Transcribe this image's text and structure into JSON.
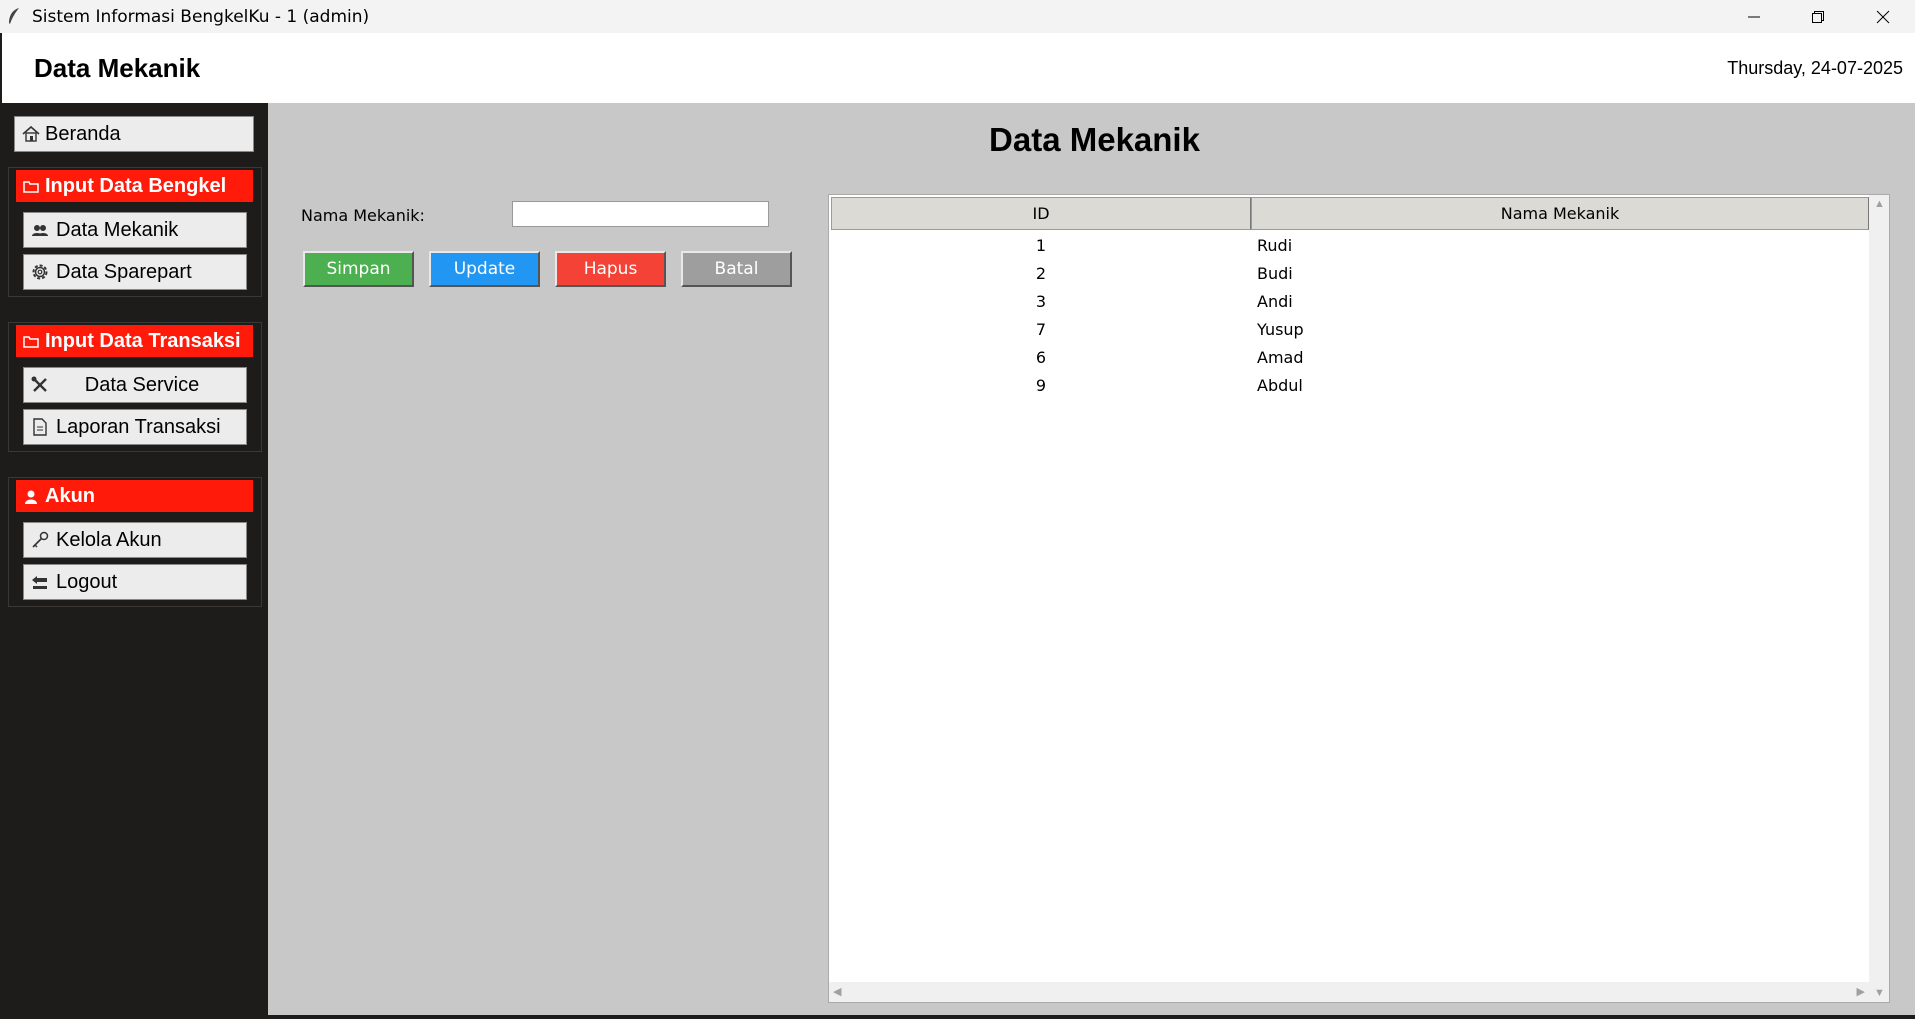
{
  "window": {
    "title": "Sistem Informasi BengkelKu - 1 (admin)"
  },
  "header": {
    "title": "Data Mekanik",
    "date": "Thursday, 24-07-2025"
  },
  "sidebar": {
    "home_label": "Beranda",
    "groups": [
      {
        "title": "Input Data Bengkel",
        "items": [
          {
            "label": "Data Mekanik",
            "icon": "users-icon"
          },
          {
            "label": "Data Sparepart",
            "icon": "gear-icon"
          }
        ]
      },
      {
        "title": "Input Data Transaksi",
        "items": [
          {
            "label": "Data Service",
            "icon": "tools-icon"
          },
          {
            "label": "Laporan Transaksi",
            "icon": "document-icon"
          }
        ]
      },
      {
        "title": "Akun",
        "items": [
          {
            "label": "Kelola Akun",
            "icon": "key-icon"
          },
          {
            "label": "Logout",
            "icon": "back-icon"
          }
        ]
      }
    ]
  },
  "main": {
    "heading": "Data Mekanik",
    "form": {
      "name_label": "Nama Mekanik:",
      "name_value": ""
    },
    "buttons": {
      "simpan": "Simpan",
      "update": "Update",
      "hapus": "Hapus",
      "batal": "Batal"
    },
    "table": {
      "columns": [
        "ID",
        "Nama Mekanik"
      ],
      "rows": [
        {
          "id": "1",
          "name": "Rudi"
        },
        {
          "id": "2",
          "name": "Budi"
        },
        {
          "id": "3",
          "name": "Andi"
        },
        {
          "id": "7",
          "name": "Yusup"
        },
        {
          "id": "6",
          "name": "Amad"
        },
        {
          "id": "9",
          "name": "Abdul"
        }
      ]
    }
  },
  "colors": {
    "accent_red": "#ff1a0a",
    "simpan": "#4caf50",
    "update": "#2196f3",
    "hapus": "#f44336",
    "batal": "#9e9e9e",
    "sidebar_bg": "#1e1c1a",
    "main_bg": "#c8c8c8"
  }
}
